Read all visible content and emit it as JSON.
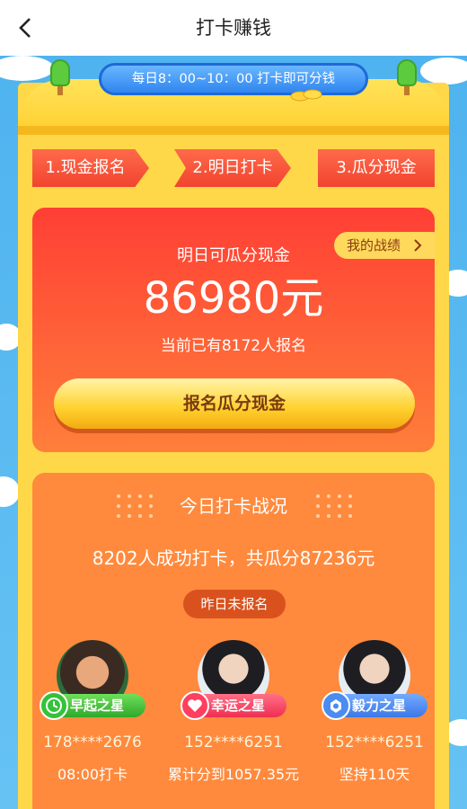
{
  "header": {
    "title": "打卡赚钱"
  },
  "banner": {
    "time_notice": "每日8：00~10：00 打卡即可分钱"
  },
  "steps": [
    "1.现金报名",
    "2.明日打卡",
    "3.瓜分现金"
  ],
  "prize_card": {
    "label": "明日可瓜分现金",
    "amount": "86980元",
    "signup_count": "当前已有8172人报名",
    "record_link": "我的战绩",
    "signup_button": "报名瓜分现金"
  },
  "today": {
    "title": "今日打卡战况",
    "summary": "8202人成功打卡，共瓜分87236元",
    "yesterday_button": "昨日未报名",
    "stars": [
      {
        "badge": "早起之星",
        "icon": "clock-icon",
        "color": "#35c23a",
        "phone": "178****2676",
        "detail": "08:00打卡"
      },
      {
        "badge": "幸运之星",
        "icon": "heart-icon",
        "color": "#ff3f5f",
        "phone": "152****6251",
        "detail": "累计分到1057.35元"
      },
      {
        "badge": "毅力之星",
        "icon": "gem-icon",
        "color": "#4a8cf0",
        "phone": "152****6251",
        "detail": "坚持110天"
      }
    ]
  }
}
